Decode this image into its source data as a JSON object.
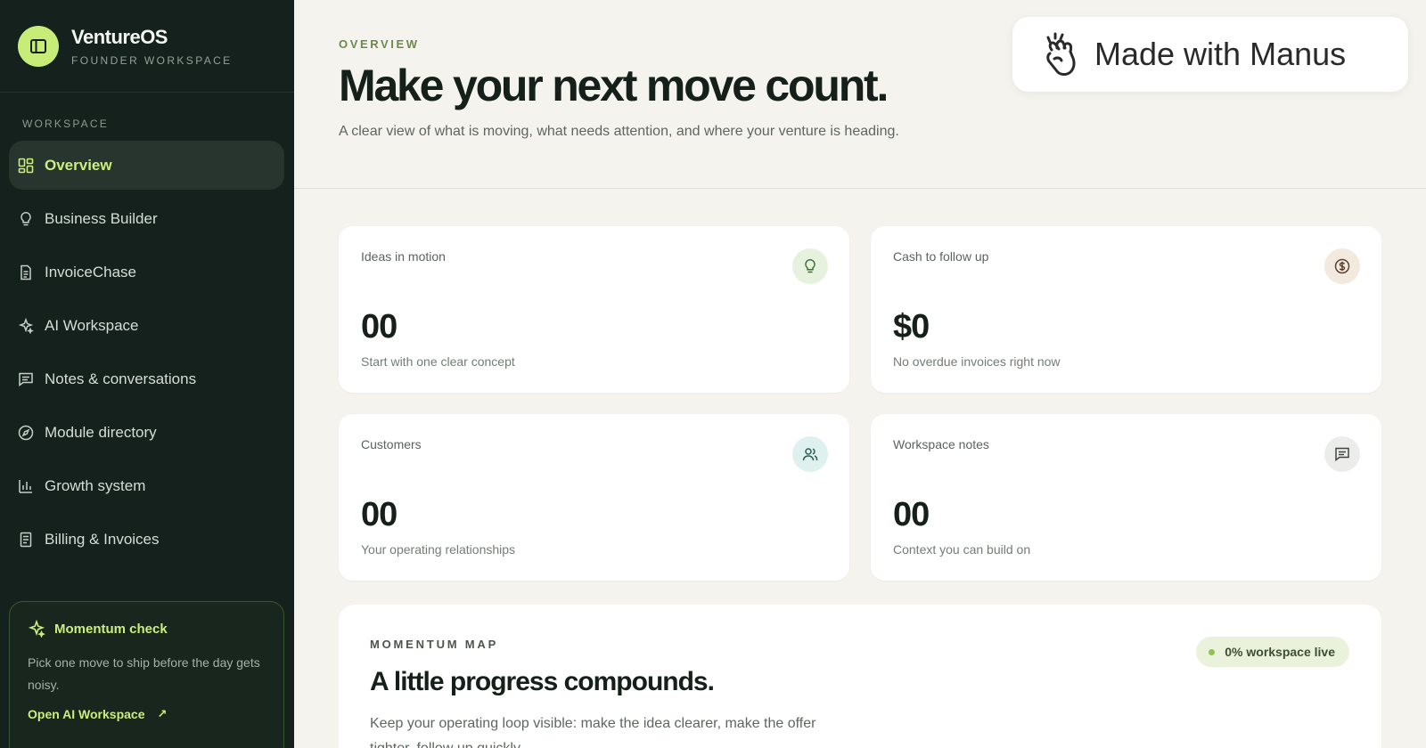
{
  "brand": {
    "name": "VentureOS",
    "subtitle": "FOUNDER WORKSPACE"
  },
  "sidebar": {
    "section_label": "WORKSPACE",
    "items": [
      {
        "label": "Overview",
        "icon": "grid-icon",
        "active": true
      },
      {
        "label": "Business Builder",
        "icon": "lightbulb-icon"
      },
      {
        "label": "InvoiceChase",
        "icon": "document-icon"
      },
      {
        "label": "AI Workspace",
        "icon": "sparkles-icon"
      },
      {
        "label": "Notes & conversations",
        "icon": "message-icon"
      },
      {
        "label": "Module directory",
        "icon": "compass-icon"
      },
      {
        "label": "Growth system",
        "icon": "bar-chart-icon"
      },
      {
        "label": "Billing & Invoices",
        "icon": "receipt-icon"
      }
    ],
    "momentum": {
      "title": "Momentum check",
      "text": "Pick one move to ship before the day gets noisy.",
      "link": "Open AI Workspace"
    }
  },
  "header": {
    "eyebrow": "OVERVIEW",
    "title": "Make your next move count.",
    "subtitle": "A clear view of what is moving, what needs attention, and where your venture is heading."
  },
  "badge": {
    "label": "Made with Manus"
  },
  "cards": [
    {
      "label": "Ideas in motion",
      "value": "00",
      "sub": "Start with one clear concept",
      "icon": "lightbulb-icon"
    },
    {
      "label": "Cash to follow up",
      "value": "$0",
      "sub": "No overdue invoices right now",
      "icon": "dollar-icon"
    },
    {
      "label": "Customers",
      "value": "00",
      "sub": "Your operating relationships",
      "icon": "users-icon"
    },
    {
      "label": "Workspace notes",
      "value": "00",
      "sub": "Context you can build on",
      "icon": "message-icon"
    }
  ],
  "momentum_map": {
    "eyebrow": "MOMENTUM MAP",
    "title": "A little progress compounds.",
    "text": "Keep your operating loop visible: make the idea clearer, make the offer tighter, follow up quickly.",
    "pill": "0% workspace live"
  },
  "colors": {
    "sidebar_bg": "#15211c",
    "accent": "#c9ef7d",
    "page_bg": "#f4f3ee"
  }
}
